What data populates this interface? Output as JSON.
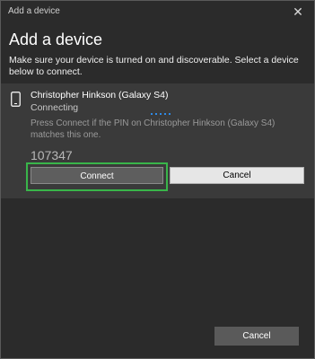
{
  "window": {
    "title": "Add a device",
    "close_glyph": "✕"
  },
  "heading": "Add a device",
  "subtitle": "Make sure your device is turned on and discoverable. Select a device below to connect.",
  "device": {
    "icon": "phone-icon",
    "name": "Christopher Hinkson (Galaxy S4)",
    "status": "Connecting",
    "pin_message": "Press Connect if the PIN on Christopher Hinkson (Galaxy S4) matches this one.",
    "pin": "107347",
    "connect_label": "Connect",
    "cancel_label": "Cancel"
  },
  "footer": {
    "cancel_label": "Cancel"
  },
  "colors": {
    "background": "#2b2b2b",
    "panel": "#3a3a3a",
    "highlight": "#39b54a",
    "progress": "#2d8ae8"
  }
}
